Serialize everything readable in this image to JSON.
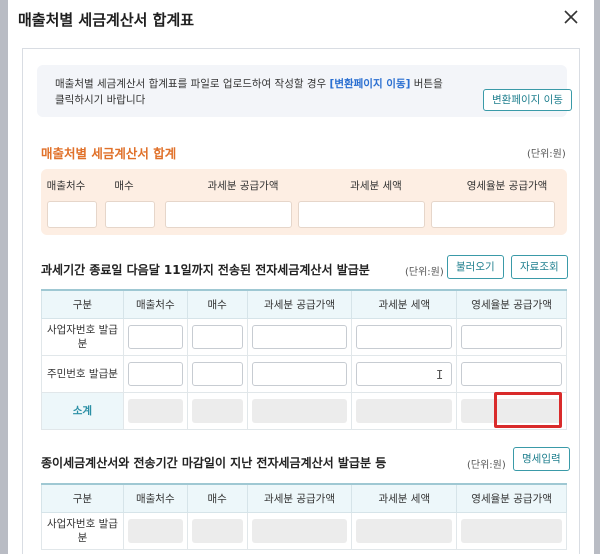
{
  "modal": {
    "title": "매출처별 세금계산서 합계표",
    "close_icon": "close-icon"
  },
  "info": {
    "line1_pre": "매출처별 세금계산서 합계표를 파일로 업로드하여 작성할 경우 ",
    "line1_link": "[변환페이지 이동]",
    "line1_post": " 버튼을",
    "line2": "클릭하시기 바랍니다",
    "button": "변환페이지 이동"
  },
  "summary": {
    "title": "매출처별 세금계산서 합계",
    "unit": "(단위:원)",
    "labels": [
      "매출처수",
      "매수",
      "과세분 공급가액",
      "과세분 세액",
      "영세율분 공급가액"
    ]
  },
  "section1": {
    "title": "과세기간 종료일 다음달 11일까지 전송된 전자세금계산서 발급분",
    "unit": "(단위:원)",
    "btn_fetch": "불러오기",
    "btn_query": "자료조회",
    "headers": [
      "구분",
      "매출처수",
      "매수",
      "과세분 공급가액",
      "과세분 세액",
      "영세율분 공급가액"
    ],
    "row1_label": "사업자번호 발급분",
    "row2_label": "주민번호 발급분",
    "row3_label": "소계"
  },
  "section2": {
    "title": "종이세금계산서와 전송기간 마감일이 지난 전자세금계산서 발급분 등",
    "unit": "(단위:원)",
    "btn_detail": "명세입력",
    "headers": [
      "구분",
      "매출처수",
      "매수",
      "과세분 공급가액",
      "과세분 세액",
      "영세율분 공급가액"
    ],
    "row1_label": "사업자번호 발급분"
  },
  "colors": {
    "accent": "#1f7f8e",
    "orange_title": "#e0712a",
    "highlight": "#d92b2b"
  }
}
